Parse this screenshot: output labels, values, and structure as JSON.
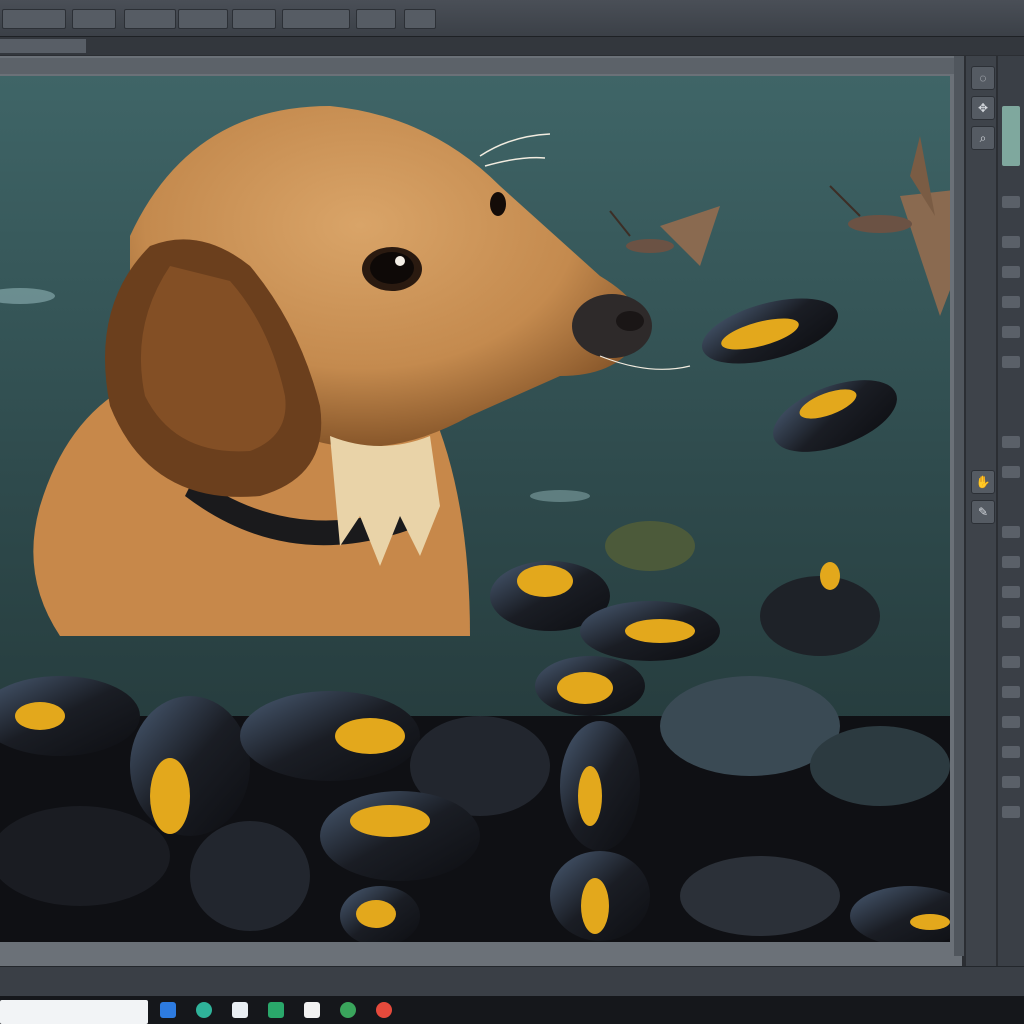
{
  "menubar": {
    "items": [
      "",
      "",
      "",
      "",
      "",
      "",
      ""
    ]
  },
  "tabbar": {
    "active_tab": ""
  },
  "tools": [
    "lasso-tool",
    "move-tool",
    "zoom-tool",
    "hand-tool",
    "brush-tool"
  ],
  "colors": {
    "ui_dark": "#2b2e33",
    "ui_mid": "#3e434a",
    "taskbar": "#15171b",
    "accent": "#e3a81c"
  },
  "taskbar": {
    "apps": [
      "mail-icon",
      "edge-icon",
      "store-icon",
      "photos-icon",
      "explorer-icon",
      "chrome-icon",
      "app-icon"
    ]
  }
}
